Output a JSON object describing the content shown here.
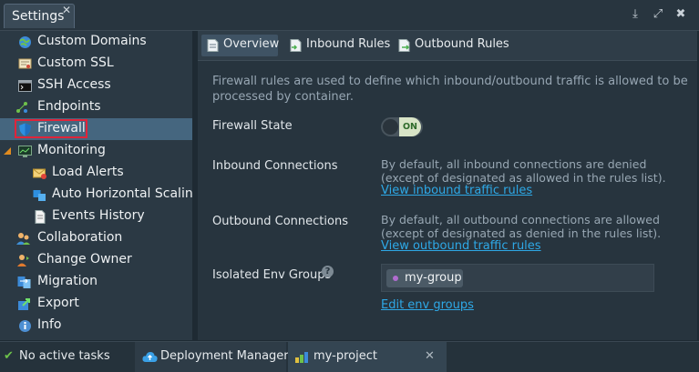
{
  "window": {
    "title": "Settings",
    "close_glyph": "✕",
    "buttons": [
      {
        "name": "download-icon",
        "glyph": "⤓"
      },
      {
        "name": "expand-icon",
        "glyph": "⤢"
      },
      {
        "name": "close-icon",
        "glyph": "✖"
      }
    ]
  },
  "sidebar": {
    "items": [
      {
        "label": "Custom Domains",
        "icon": "globe-icon"
      },
      {
        "label": "Custom SSL",
        "icon": "certificate-icon"
      },
      {
        "label": "SSH Access",
        "icon": "terminal-icon"
      },
      {
        "label": "Endpoints",
        "icon": "endpoints-icon"
      },
      {
        "label": "Firewall",
        "icon": "shield-icon",
        "selected": true
      },
      {
        "label": "Monitoring",
        "icon": "monitor-icon",
        "expanded": true
      },
      {
        "label": "Load Alerts",
        "icon": "mail-alert-icon"
      },
      {
        "label": "Auto Horizontal Scaling",
        "icon": "scaling-icon"
      },
      {
        "label": "Events History",
        "icon": "document-icon"
      },
      {
        "label": "Collaboration",
        "icon": "users-icon"
      },
      {
        "label": "Change Owner",
        "icon": "change-owner-icon"
      },
      {
        "label": "Migration",
        "icon": "migration-icon"
      },
      {
        "label": "Export",
        "icon": "export-icon"
      },
      {
        "label": "Info",
        "icon": "info-icon"
      }
    ]
  },
  "tabs": [
    {
      "label": "Overview",
      "icon": "overview-icon",
      "active": true
    },
    {
      "label": "Inbound Rules",
      "icon": "inbound-rules-icon"
    },
    {
      "label": "Outbound Rules",
      "icon": "outbound-rules-icon"
    }
  ],
  "overview": {
    "description": "Firewall rules are used to define which inbound/outbound traffic is allowed to be processed by container.",
    "firewall_state_label": "Firewall State",
    "toggle_text": "ON",
    "inbound_label": "Inbound Connections",
    "inbound_text": "By default, all inbound connections are denied (except of designated as allowed in the rules list).",
    "inbound_link": "View inbound traffic rules",
    "outbound_label": "Outbound Connections",
    "outbound_text": "By default, all outbound connections are allowed (except of designated as denied in the rules list).",
    "outbound_link": "View outbound traffic rules",
    "isolated_label": "Isolated Env Groups",
    "help_glyph": "?",
    "group_chip": "my-group",
    "edit_link": "Edit env groups"
  },
  "statusbar": {
    "tasks": "No active tasks",
    "tasks_glyph": "✔",
    "deployment_manager": "Deployment Manager",
    "project": "my-project",
    "close_glyph": "✕"
  },
  "colors": {
    "accent_link": "#2ea8e6",
    "selected_row": "#45667f",
    "highlight_outline": "#e0243a",
    "toggle_on": "#d8e4c7"
  }
}
